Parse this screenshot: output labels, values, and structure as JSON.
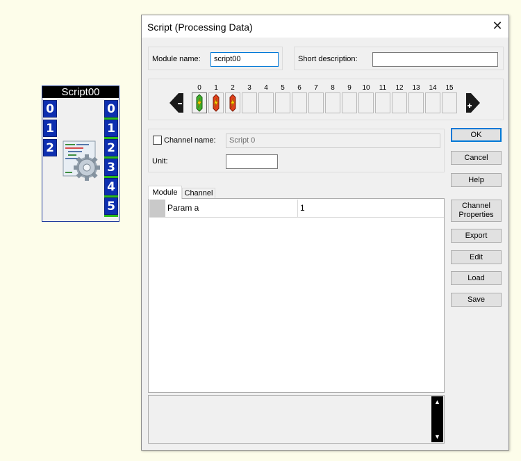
{
  "module_block": {
    "title": "Script00",
    "inputs": [
      "0",
      "1",
      "2"
    ],
    "outputs": [
      "0",
      "1",
      "2",
      "3",
      "4",
      "5"
    ]
  },
  "dialog": {
    "title": "Script (Processing Data)",
    "close_glyph": "✕",
    "module_name_label": "Module name:",
    "module_name_value": "script00",
    "short_description_label": "Short description:",
    "short_description_value": "",
    "channels": [
      "0",
      "1",
      "2",
      "3",
      "4",
      "5",
      "6",
      "7",
      "8",
      "9",
      "10",
      "11",
      "12",
      "13",
      "14",
      "15"
    ],
    "active_channels": [
      {
        "index": "0",
        "color": "#3fae2a",
        "state": "selected"
      },
      {
        "index": "1",
        "color": "#e2401b",
        "state": "normal"
      },
      {
        "index": "2",
        "color": "#e2401b",
        "state": "normal"
      }
    ],
    "channel_name_label": "Channel name:",
    "channel_name_value": "Script 0",
    "channel_name_checked": false,
    "unit_label": "Unit:",
    "unit_value": "",
    "tabs": [
      {
        "label": "Module",
        "active": true
      },
      {
        "label": "Channel",
        "active": false
      }
    ],
    "params": [
      {
        "name": "Param a",
        "value": "1"
      }
    ],
    "buttons": {
      "ok": "OK",
      "cancel": "Cancel",
      "help": "Help",
      "channel_properties_line1": "Channel",
      "channel_properties_line2": "Properties",
      "export": "Export",
      "edit": "Edit",
      "load": "Load",
      "save": "Save"
    },
    "colors": {
      "accent": "#0078d7",
      "port_blue": "#0d2fb0",
      "port_green": "#2dbb1c",
      "canvas": "#fdfdea"
    }
  }
}
